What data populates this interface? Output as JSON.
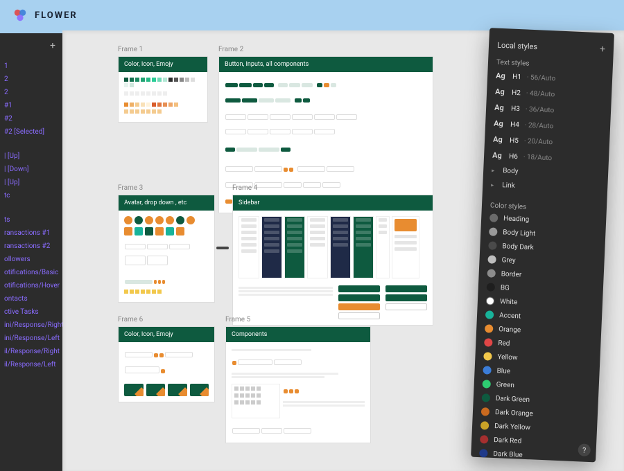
{
  "app": {
    "name": "FLOWER"
  },
  "layers": {
    "items": [
      "1",
      "2",
      "2",
      "#1",
      "#2",
      "#2 [Selected]",
      "",
      "",
      "| [Up]",
      "| [Down]",
      "| [Up]",
      "tc",
      "",
      "",
      "ts",
      "ransactions #1",
      "ransactions #2",
      "ollowers",
      "otifications/Basic",
      "otifications/Hover",
      "ontacts",
      "ctive Tasks",
      "ini/Response/Right",
      "ini/Response/Left",
      "il/Response/Right",
      "il/Response/Left"
    ]
  },
  "frames": [
    {
      "label": "Frame 1",
      "title": "Color, Icon, Emojy"
    },
    {
      "label": "Frame 2",
      "title": "Button, Inputs, all components"
    },
    {
      "label": "Frame 3",
      "title": "Avatar, drop down , etc"
    },
    {
      "label": "Frame 4",
      "title": "Sidebar"
    },
    {
      "label": "Frame 6",
      "title": "Color, Icon, Emojy"
    },
    {
      "label": "Frame 5",
      "title": "Components"
    }
  ],
  "swatches_dark": [
    "#0e5a3f",
    "#13714f",
    "#1a8a61",
    "#1fa373",
    "#24b985",
    "#2acd97",
    "#6fd8b6",
    "#b3e9d6",
    "#2c2c2c",
    "#555",
    "#888",
    "#bbb",
    "#ddd",
    "#fff",
    "#e6f3ee",
    "#cfe7dd"
  ],
  "swatches_warm": [
    "#e88c30",
    "#efb066",
    "#f4cb8f",
    "#f9e1b8",
    "#fff2da",
    "#d95c2b",
    "#e0763f",
    "#e78f54",
    "#eea769",
    "#f4bf7e",
    "#fff",
    "#fff"
  ],
  "inspector": {
    "title": "Local styles",
    "text_styles_label": "Text styles",
    "text_styles": [
      {
        "name": "H1",
        "spec": "56/Auto"
      },
      {
        "name": "H2",
        "spec": "48/Auto"
      },
      {
        "name": "H3",
        "spec": "36/Auto"
      },
      {
        "name": "H4",
        "spec": "28/Auto"
      },
      {
        "name": "H5",
        "spec": "20/Auto"
      },
      {
        "name": "H6",
        "spec": "18/Auto"
      }
    ],
    "text_groups": [
      "Body",
      "Link"
    ],
    "color_styles_label": "Color styles",
    "colors": [
      {
        "name": "Heading",
        "hex": "#6b6b6b"
      },
      {
        "name": "Body Light",
        "hex": "#9a9a9a"
      },
      {
        "name": "Body Dark",
        "hex": "#4a4a4a"
      },
      {
        "name": "Grey",
        "hex": "#bdbdbd"
      },
      {
        "name": "Border",
        "hex": "#8c8c8c"
      },
      {
        "name": "BG",
        "hex": "#1e1e1e"
      },
      {
        "name": "White",
        "hex": "#ffffff"
      },
      {
        "name": "Accent",
        "hex": "#18b39a"
      },
      {
        "name": "Orange",
        "hex": "#e88c30"
      },
      {
        "name": "Red",
        "hex": "#e04646"
      },
      {
        "name": "Yellow",
        "hex": "#f2c84b"
      },
      {
        "name": "Blue",
        "hex": "#3b7dd8"
      },
      {
        "name": "Green",
        "hex": "#2ecc71"
      },
      {
        "name": "Dark Green",
        "hex": "#0e5a3f"
      },
      {
        "name": "Dark Orange",
        "hex": "#c96a1f"
      },
      {
        "name": "Dark Yellow",
        "hex": "#c9a227"
      },
      {
        "name": "Dark Red",
        "hex": "#a52f2f"
      },
      {
        "name": "Dark Blue",
        "hex": "#1f3a8a"
      }
    ],
    "help": "?"
  }
}
